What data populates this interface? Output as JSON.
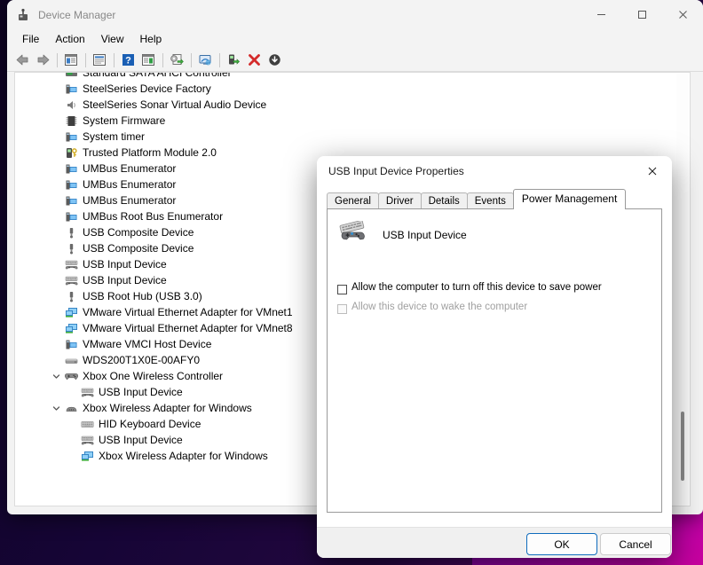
{
  "window": {
    "title": "Device Manager",
    "icon": "device-manager-icon",
    "controls": {
      "minimize": "minimize-icon",
      "maximize": "maximize-icon",
      "close": "close-icon"
    }
  },
  "menubar": {
    "items": [
      {
        "label": "File"
      },
      {
        "label": "Action"
      },
      {
        "label": "View"
      },
      {
        "label": "Help"
      }
    ]
  },
  "toolbar": {
    "buttons": [
      {
        "name": "back-icon"
      },
      {
        "name": "forward-icon"
      },
      {
        "name": "show-hide-console-tree-icon"
      },
      {
        "name": "properties-icon"
      },
      {
        "name": "help-icon"
      },
      {
        "name": "show-hide-action-pane-icon"
      },
      {
        "name": "update-driver-icon"
      },
      {
        "name": "scan-for-hardware-changes-icon"
      },
      {
        "name": "add-legacy-hardware-icon"
      },
      {
        "name": "uninstall-device-icon"
      },
      {
        "name": "disable-device-icon"
      }
    ]
  },
  "tree": {
    "nodes": [
      {
        "label": "Standard SATA AHCI Controller",
        "icon": "storage-controller-icon",
        "level": 1,
        "expander": "none"
      },
      {
        "label": "SteelSeries Device Factory",
        "icon": "system-device-icon",
        "level": 1,
        "expander": "none"
      },
      {
        "label": "SteelSeries Sonar Virtual Audio Device",
        "icon": "audio-device-icon",
        "level": 1,
        "expander": "none"
      },
      {
        "label": "System Firmware",
        "icon": "firmware-icon",
        "level": 1,
        "expander": "none"
      },
      {
        "label": "System timer",
        "icon": "system-device-icon",
        "level": 1,
        "expander": "none"
      },
      {
        "label": "Trusted Platform Module 2.0",
        "icon": "security-device-icon",
        "level": 1,
        "expander": "none"
      },
      {
        "label": "UMBus Enumerator",
        "icon": "system-device-icon",
        "level": 1,
        "expander": "none"
      },
      {
        "label": "UMBus Enumerator",
        "icon": "system-device-icon",
        "level": 1,
        "expander": "none"
      },
      {
        "label": "UMBus Enumerator",
        "icon": "system-device-icon",
        "level": 1,
        "expander": "none"
      },
      {
        "label": "UMBus Root Bus Enumerator",
        "icon": "system-device-icon",
        "level": 1,
        "expander": "none"
      },
      {
        "label": "USB Composite Device",
        "icon": "usb-device-icon",
        "level": 1,
        "expander": "none"
      },
      {
        "label": "USB Composite Device",
        "icon": "usb-device-icon",
        "level": 1,
        "expander": "none"
      },
      {
        "label": "USB Input Device",
        "icon": "usb-input-device-icon",
        "level": 1,
        "expander": "none"
      },
      {
        "label": "USB Input Device",
        "icon": "usb-input-device-icon",
        "level": 1,
        "expander": "none"
      },
      {
        "label": "USB Root Hub (USB 3.0)",
        "icon": "usb-device-icon",
        "level": 1,
        "expander": "none"
      },
      {
        "label": "VMware Virtual Ethernet Adapter for VMnet1",
        "icon": "network-adapter-icon",
        "level": 1,
        "expander": "none"
      },
      {
        "label": "VMware Virtual Ethernet Adapter for VMnet8",
        "icon": "network-adapter-icon",
        "level": 1,
        "expander": "none"
      },
      {
        "label": "VMware VMCI Host Device",
        "icon": "system-device-icon",
        "level": 1,
        "expander": "none"
      },
      {
        "label": "WDS200T1X0E-00AFY0",
        "icon": "disk-drive-icon",
        "level": 1,
        "expander": "none"
      },
      {
        "label": "Xbox One Wireless Controller",
        "icon": "gamepad-icon",
        "level": 1,
        "expander": "expanded"
      },
      {
        "label": "USB Input Device",
        "icon": "usb-input-device-icon",
        "level": 2,
        "expander": "none"
      },
      {
        "label": "Xbox Wireless Adapter for Windows",
        "icon": "wireless-adapter-icon",
        "level": 1,
        "expander": "expanded"
      },
      {
        "label": "HID Keyboard Device",
        "icon": "keyboard-icon",
        "level": 2,
        "expander": "none"
      },
      {
        "label": "USB Input Device",
        "icon": "usb-input-device-icon",
        "level": 2,
        "expander": "none"
      },
      {
        "label": "Xbox Wireless Adapter for Windows",
        "icon": "network-adapter-icon",
        "level": 2,
        "expander": "none"
      }
    ]
  },
  "dialog": {
    "title": "USB Input Device Properties",
    "close_icon": "close-icon",
    "tabs": [
      {
        "label": "General",
        "active": false
      },
      {
        "label": "Driver",
        "active": false
      },
      {
        "label": "Details",
        "active": false
      },
      {
        "label": "Events",
        "active": false
      },
      {
        "label": "Power Management",
        "active": true
      }
    ],
    "device": {
      "name": "USB Input Device",
      "icon": "usb-input-device-icon"
    },
    "options": [
      {
        "label": "Allow the computer to turn off this device to save power",
        "checked": false,
        "disabled": false
      },
      {
        "label": "Allow this device to wake the computer",
        "checked": false,
        "disabled": true
      }
    ],
    "buttons": {
      "ok": "OK",
      "cancel": "Cancel"
    }
  },
  "colors": {
    "accent": "#0f6cbd",
    "window_bg": "#f3f3f3",
    "panel_bg": "#ffffff",
    "disabled_text": "#a0a0a0"
  }
}
